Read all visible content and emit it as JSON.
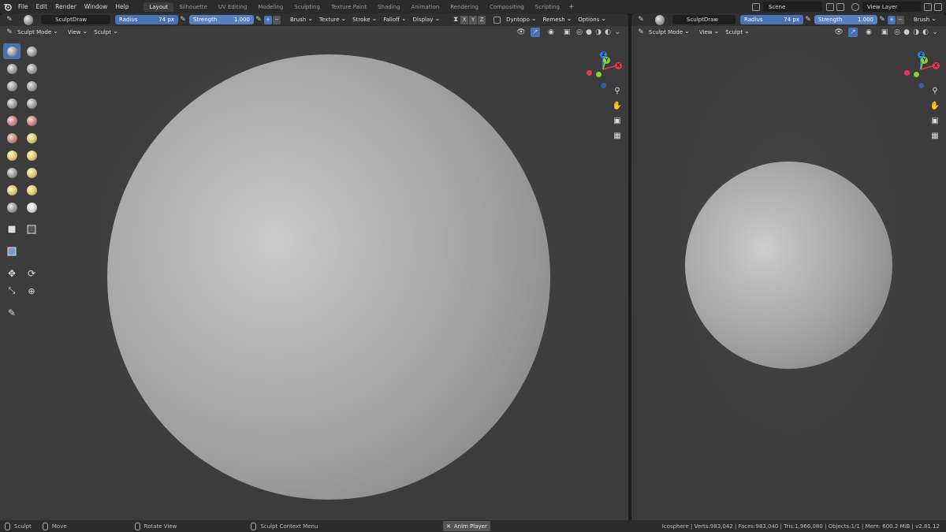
{
  "topbar": {
    "menu": [
      "File",
      "Edit",
      "Render",
      "Window",
      "Help"
    ],
    "workspaces": [
      "Layout",
      "Silhouette",
      "UV Editing",
      "Modeling",
      "Sculpting",
      "Texture Paint",
      "Shading",
      "Animation",
      "Rendering",
      "Compositing",
      "Scripting"
    ],
    "active_workspace": "Layout",
    "add_tab": "+",
    "scene": "Scene",
    "view_layer": "View Layer"
  },
  "left_viewport": {
    "brush_name": "SculptDraw",
    "radius_label": "Radius",
    "radius_value": "74 px",
    "strength_label": "Strength",
    "strength_value": "1.000",
    "plus": "+",
    "minus": "−",
    "menus": [
      "Brush",
      "Texture",
      "Stroke",
      "Falloff",
      "Display"
    ],
    "axes": [
      "X",
      "Y",
      "Z"
    ],
    "dyntopo": "Dyntopo",
    "remesh": "Remesh",
    "options": "Options",
    "mode": "Sculpt Mode",
    "view": "View",
    "sculpt": "Sculpt"
  },
  "right_viewport": {
    "brush_name": "SculptDraw",
    "radius_label": "Radius",
    "radius_value": "74 px",
    "strength_label": "Strength",
    "strength_value": "1.000",
    "plus": "+",
    "minus": "−",
    "brush_menu": "Brush",
    "mode": "Sculpt Mode",
    "view": "View",
    "sculpt": "Sculpt"
  },
  "gizmo": {
    "x": "X",
    "y": "Y",
    "z": "Z"
  },
  "statusbar": {
    "sculpt": "Sculpt",
    "move": "Move",
    "rotate": "Rotate View",
    "context": "Sculpt Context Menu",
    "anim_player": "Anim Player",
    "stats": "Icosphere | Verts:983,042 | Faces:983,040 | Tris:1,966,080 | Objects:1/1 | Mem: 600.2 MiB | v2.81.12"
  },
  "colors": {
    "accent": "#4772b3",
    "viewport": "#3d3d3d",
    "x_axis": "#e8384f",
    "y_axis": "#8bd12f",
    "z_axis": "#2f83e8"
  }
}
